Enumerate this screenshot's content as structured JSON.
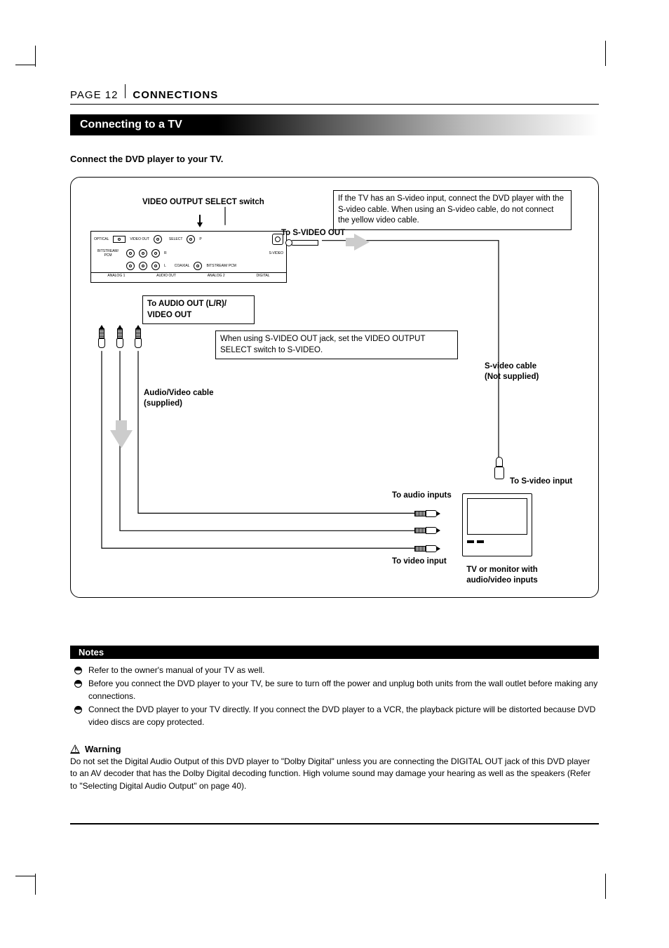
{
  "header": {
    "page_prefix": "PAGE 12",
    "section": "CONNECTIONS"
  },
  "band_title": "Connecting to a TV",
  "intro": "Connect the DVD player to your TV.",
  "diagram": {
    "video_output_switch": "VIDEO OUTPUT SELECT switch",
    "svideo_info": "If the TV has an S-video input, connect the DVD player with the S-video cable. When using an S-video cable, do not connect the yellow video cable.",
    "to_svideo_out": "To S-VIDEO OUT",
    "to_audio_out": "To AUDIO OUT (L/R)/\nVIDEO OUT",
    "switch_note": "When using S-VIDEO OUT jack, set the VIDEO OUTPUT SELECT switch to S-VIDEO.",
    "av_cable": "Audio/Video cable\n(supplied)",
    "svideo_cable": "S-video cable\n(Not supplied)",
    "to_svideo_input": "To S-video input",
    "to_audio_inputs": "To audio inputs",
    "to_video_input": "To video input",
    "tv_label": "TV or monitor with\naudio/video inputs",
    "panel_text": {
      "optical": "OPTICAL",
      "video_out": "VIDEO OUT",
      "svideo": "S-VIDEO",
      "bitstream_pcm": "BITSTREAM/\nPCM",
      "coaxial": "COAXIAL",
      "analog1": "ANALOG 1",
      "audio_out": "AUDIO OUT",
      "analog2": "ANALOG 2",
      "digital": "DIGITAL",
      "select": "SELECT",
      "p": "P",
      "r": "R",
      "l": "L"
    }
  },
  "notes_label": "Notes",
  "notes": [
    "Refer to the owner's manual of your TV as well.",
    "Before you connect the DVD player to your TV, be sure to turn off the power and unplug both units from the wall outlet before making any connections.",
    "Connect the DVD player to your TV directly. If you connect the DVD player to a VCR, the playback picture will be distorted because DVD video discs are copy protected."
  ],
  "warning_label": "Warning",
  "warning_body": "Do not set the Digital Audio Output of this DVD player to \"Dolby Digital\" unless you are connecting the DIGITAL OUT jack of this DVD player to an AV decoder that has the Dolby Digital decoding function. High volume sound may damage your hearing as well as the speakers (Refer to \"Selecting Digital Audio Output\" on page 40)."
}
